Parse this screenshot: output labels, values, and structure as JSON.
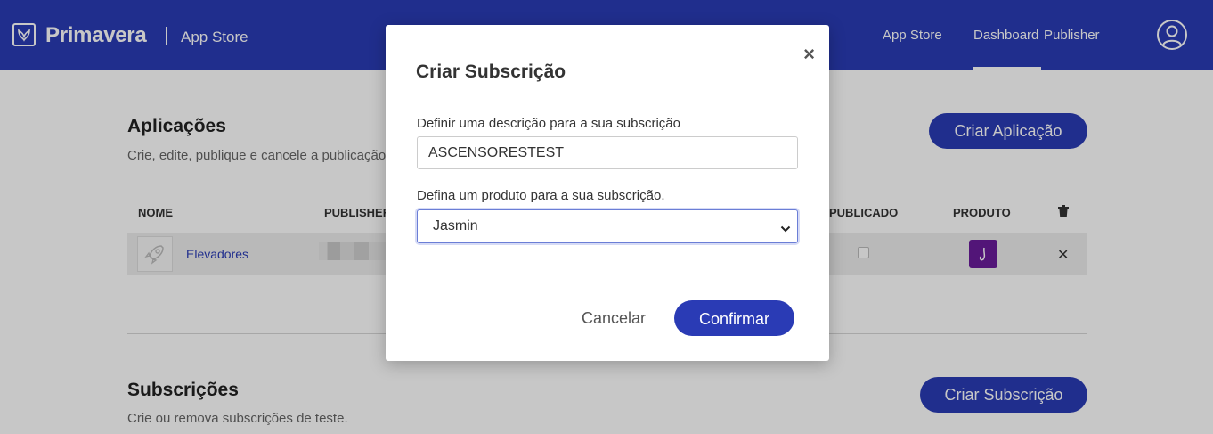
{
  "header": {
    "brand": "Primavera",
    "subtitle": "App Store",
    "nav": [
      {
        "label": "App Store"
      },
      {
        "label": "Dashboard",
        "active": true
      },
      {
        "label": "Publisher"
      }
    ],
    "icons": {
      "logo": "primavera-logo-icon",
      "user": "user-avatar-icon"
    }
  },
  "applications": {
    "title": "Aplicações",
    "subtitle": "Crie, edite, publique e cancele a publicação",
    "create_button": "Criar Aplicação",
    "columns": [
      "NOME",
      "PUBLISHER",
      "PUBLICADO",
      "PRODUTO"
    ],
    "rows": [
      {
        "name": "Elevadores",
        "publisher": "",
        "published": false,
        "product": "Jasmin"
      }
    ]
  },
  "subscriptions": {
    "title": "Subscrições",
    "subtitle": "Crie ou remova subscrições de teste.",
    "create_button": "Criar Subscrição"
  },
  "modal": {
    "title": "Criar Subscrição",
    "close": "×",
    "description_label": "Definir uma descrição para a sua subscrição",
    "description_value": "ASCENSORESTEST",
    "product_label": "Defina um produto para a sua subscrição.",
    "product_value": "Jasmin",
    "cancel_label": "Cancelar",
    "confirm_label": "Confirmar"
  },
  "colors": {
    "primary": "#2a3bb5",
    "product_badge": "#6a1b9a",
    "link": "#2a3bb5"
  }
}
